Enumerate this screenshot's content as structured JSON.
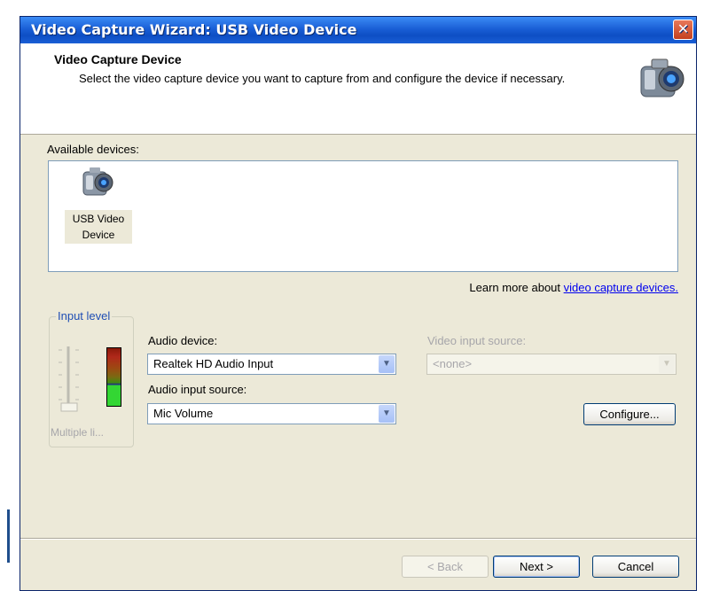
{
  "window": {
    "title": "Video Capture Wizard: USB Video Device",
    "close_label": "✕"
  },
  "header": {
    "title": "Video Capture Device",
    "description": "Select the video capture device you want to capture from and configure the device if necessary.",
    "icon": "video-camera-icon"
  },
  "devices": {
    "label": "Available devices:",
    "items": [
      {
        "label": "USB Video Device",
        "icon": "webcam-icon"
      }
    ]
  },
  "learn_more": {
    "prefix": "Learn more about ",
    "link": "video capture devices."
  },
  "input_level": {
    "title": "Input level",
    "footer": "Multiple li..."
  },
  "audio": {
    "device_label": "Audio device:",
    "device_value": "Realtek HD Audio Input",
    "source_label": "Audio input source:",
    "source_value": "Mic Volume"
  },
  "video": {
    "source_label": "Video input source:",
    "source_value": "<none>"
  },
  "buttons": {
    "configure": "Configure...",
    "back": "< Back",
    "next": "Next >",
    "cancel": "Cancel"
  },
  "colors": {
    "title_bar": "#1a5fd6",
    "dialog_bg": "#ece9d8",
    "link": "#0000ee"
  }
}
